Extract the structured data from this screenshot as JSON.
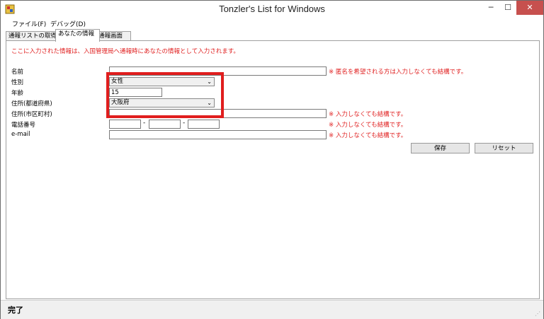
{
  "window": {
    "title": "Tonzler's List for Windows",
    "min_glyph": "─",
    "max_glyph": "☐",
    "close_glyph": "✕"
  },
  "menu": [
    {
      "label": "ファイル(F)"
    },
    {
      "label": "デバッグ(D)"
    }
  ],
  "tabs": [
    {
      "label": "通報リストの取得",
      "active": false
    },
    {
      "label": "あなたの情報",
      "active": true
    },
    {
      "label": "通報画面",
      "active": false
    }
  ],
  "form": {
    "notice": "ここに入力された情報は、入国管理局へ通報時にあなたの情報として入力されます。",
    "name_label": "名前",
    "name_value": "",
    "name_hint": "※ 匿名を希望される方は入力しなくても結構です。",
    "gender_label": "性別",
    "gender_value": "女性",
    "age_label": "年齢",
    "age_value": "15",
    "prefecture_label": "住所(都道府県)",
    "prefecture_value": "大阪府",
    "city_label": "住所(市区町村)",
    "city_value": "",
    "city_hint": "※ 入力しなくても結構です。",
    "phone_label": "電話番号",
    "phone_part1": "",
    "phone_part2": "",
    "phone_part3": "",
    "phone_sep": "-",
    "phone_hint": "※ 入力しなくても結構です。",
    "email_label": "e-mail",
    "email_value": "",
    "email_hint": "※ 入力しなくても結構です。",
    "dropdown_glyph": "⌄"
  },
  "buttons": {
    "save": "保存",
    "reset": "リセット"
  },
  "status": {
    "text": "完了",
    "grip": "⋰"
  },
  "colors": {
    "highlight": "#e01e1e",
    "hint_text": "#e02020",
    "close_button": "#c7504e"
  }
}
